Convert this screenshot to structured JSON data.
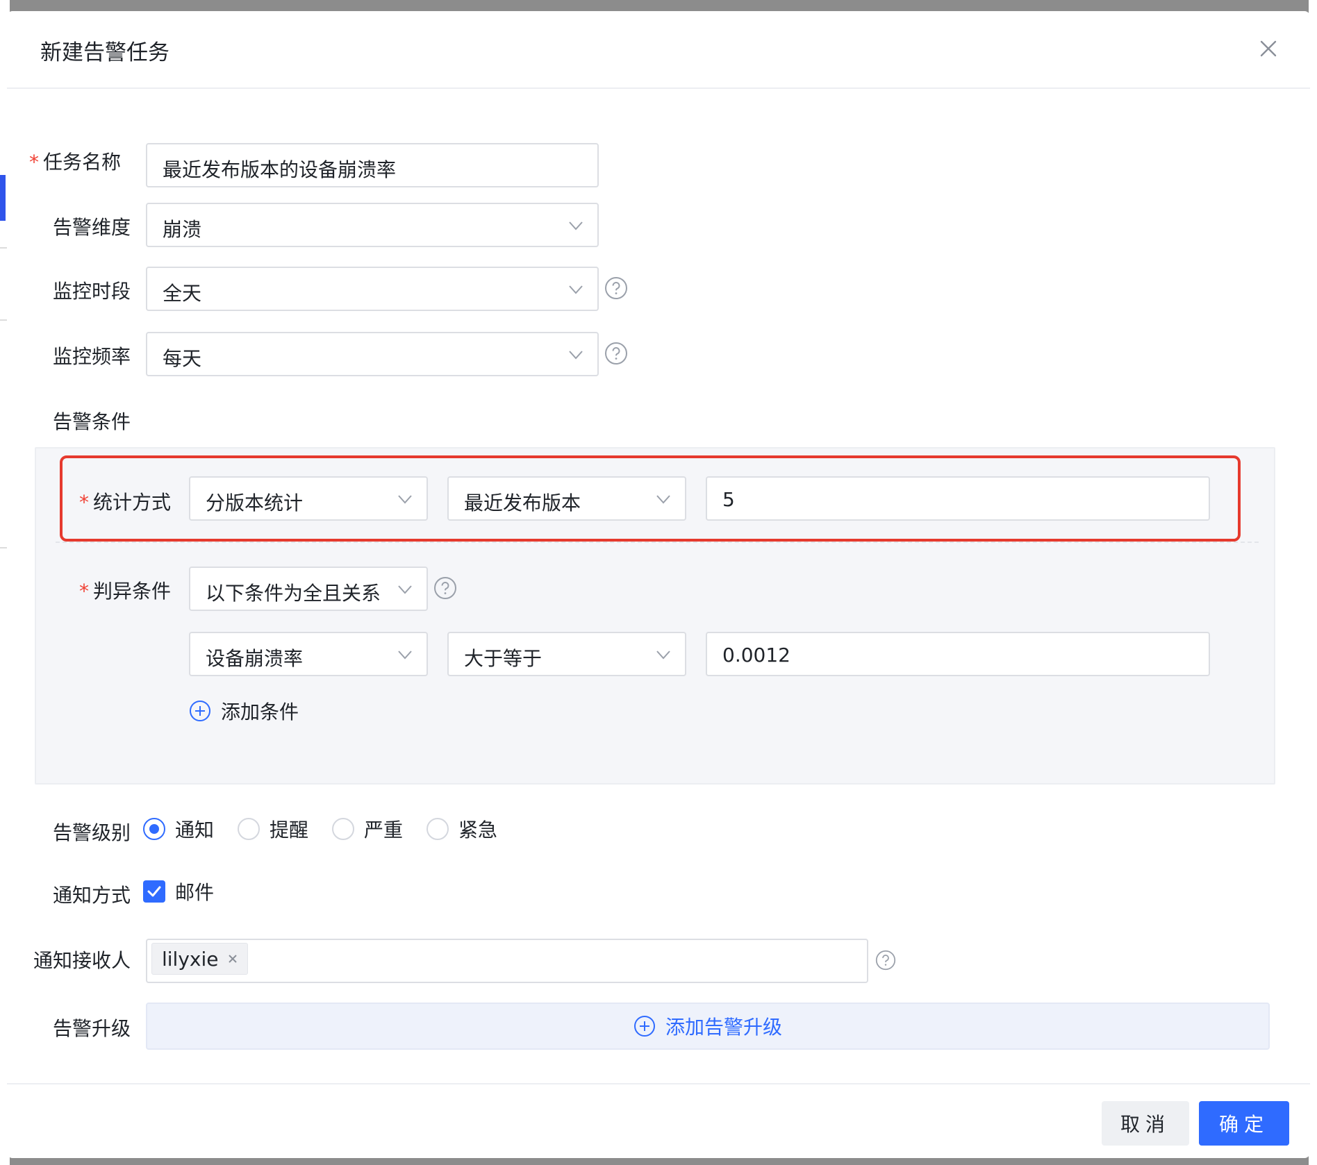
{
  "dialog": {
    "title": "新建告警任务",
    "close_icon": "close-icon"
  },
  "form": {
    "task_name": {
      "label": "任务名称",
      "required": "*",
      "value": "最近发布版本的设备崩溃率"
    },
    "alert_dimension": {
      "label": "告警维度",
      "value": "崩溃"
    },
    "monitor_period": {
      "label": "监控时段",
      "value": "全天"
    },
    "monitor_frequency": {
      "label": "监控频率",
      "value": "每天"
    },
    "alert_conditions": {
      "label": "告警条件",
      "stat_method": {
        "label": "统计方式",
        "required": "*",
        "select1": "分版本统计",
        "select2": "最近发布版本",
        "input": "5"
      },
      "judge_condition": {
        "label": "判异条件",
        "required": "*",
        "relation": "以下条件为全且关系",
        "rule": {
          "metric": "设备崩溃率",
          "operator": "大于等于",
          "value": "0.0012"
        },
        "add_label": "添加条件"
      }
    },
    "alert_level": {
      "label": "告警级别",
      "options": [
        "通知",
        "提醒",
        "严重",
        "紧急"
      ],
      "selected": "通知"
    },
    "notify_method": {
      "label": "通知方式",
      "option": "邮件",
      "checked": true
    },
    "recipients": {
      "label": "通知接收人",
      "tags": [
        "lilyxie"
      ]
    },
    "escalation": {
      "label": "告警升级",
      "add_label": "添加告警升级"
    }
  },
  "footer": {
    "cancel_label": "取消",
    "ok_label": "确定"
  },
  "colors": {
    "primary": "#2f6bff",
    "required": "#f04134",
    "highlight": "#e63a2e"
  }
}
